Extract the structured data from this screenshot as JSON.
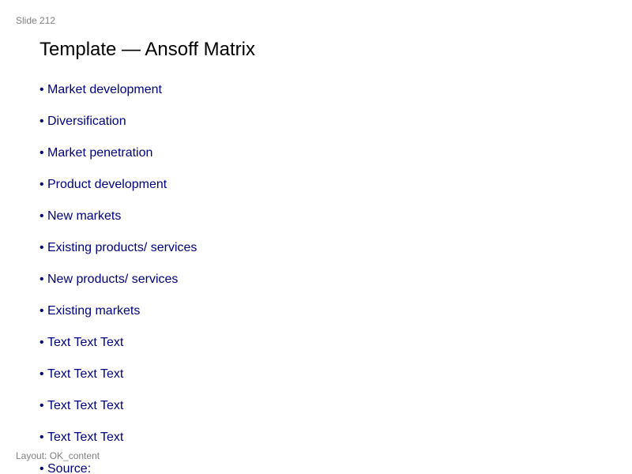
{
  "slide_label": "Slide 212",
  "title": "Template — Ansoff Matrix",
  "bullet_glyph": "•",
  "bullets": [
    "Market development",
    "Diversification",
    "Market penetration",
    "Product development",
    "New markets",
    "Existing products/ services",
    "New products/ services",
    "Existing markets",
    "Text Text Text",
    "Text Text Text",
    "Text Text Text",
    "Text Text Text",
    "Source:"
  ],
  "layout_label": "Layout: OK_content",
  "colors": {
    "bullet_text": "#000080",
    "meta_text": "#808080",
    "title_text": "#000000",
    "background": "#ffffff"
  }
}
